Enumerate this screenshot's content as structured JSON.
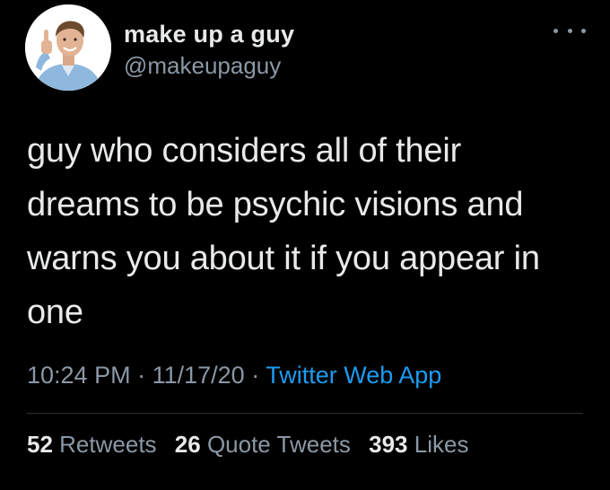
{
  "author": {
    "display_name": "make up a guy",
    "handle": "@makeupaguy",
    "avatar_icon": "profile-photo-thumbs-up-man"
  },
  "menu": {
    "more_icon": "ellipsis-icon"
  },
  "tweet": {
    "lines": [
      "guy who considers all of their",
      "dreams to be psychic visions and",
      "warns you about it if you appear in",
      "one"
    ]
  },
  "meta": {
    "time": "10:24 PM",
    "separator": "·",
    "date": "11/17/20",
    "source": "Twitter Web App"
  },
  "stats": {
    "retweets_count": "52",
    "retweets_label": "Retweets",
    "quotes_count": "26",
    "quotes_label": "Quote Tweets",
    "likes_count": "393",
    "likes_label": "Likes"
  },
  "colors": {
    "background": "#000000",
    "text": "#e7e9ea",
    "secondary": "#8b98a5",
    "link": "#1d9bf0"
  }
}
